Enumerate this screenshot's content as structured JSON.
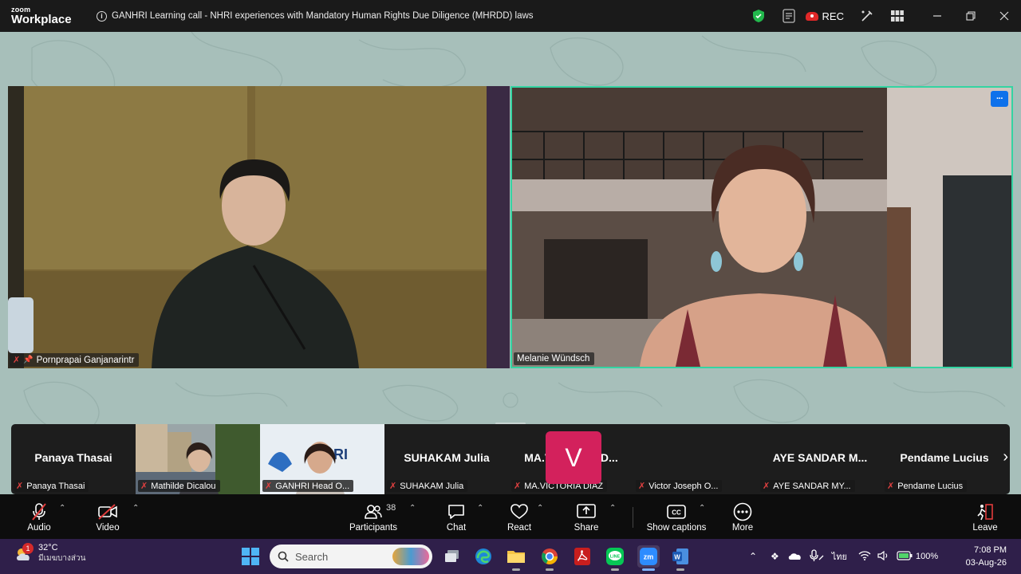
{
  "app": {
    "logo_top": "zoom",
    "logo_bottom": "Workplace"
  },
  "meeting": {
    "title": "GANHRI Learning call - NHRI experiences with Mandatory Human Rights Due Diligence (MHRDD) laws",
    "rec_label": "REC"
  },
  "speakers": [
    {
      "name": "Pornprapai Ganjanarintr",
      "muted": true,
      "pinned": true
    },
    {
      "name": "Melanie Wündsch",
      "muted": false,
      "active": true
    }
  ],
  "gallery": [
    {
      "display": "Panaya Thasai",
      "name": "Panaya Thasai",
      "video": false
    },
    {
      "display": "",
      "name": "Mathilde Dicalou",
      "video": true
    },
    {
      "display": "",
      "name": "GANHRI Head O...",
      "video": true
    },
    {
      "display": "SUHAKAM Julia",
      "name": "SUHAKAM Julia",
      "video": false
    },
    {
      "display": "MA.VICTORIA  D...",
      "name": "MA.VICTORIA DIAZ",
      "video": false
    },
    {
      "display": "V",
      "name": "Victor Joseph O...",
      "video": false
    },
    {
      "display": "AYE SANDAR M...",
      "name": "AYE SANDAR MY...",
      "video": false
    },
    {
      "display": "Pendame Lucius",
      "name": "Pendame Lucius",
      "video": false
    }
  ],
  "toolbar": {
    "audio": "Audio",
    "video": "Video",
    "participants": "Participants",
    "participants_count": "38",
    "chat": "Chat",
    "react": "React",
    "share": "Share",
    "captions": "Show captions",
    "more": "More",
    "leave": "Leave"
  },
  "taskbar": {
    "temperature": "32°C",
    "weather_text": "มีเมฆบางส่วน",
    "weather_badge": "1",
    "search_placeholder": "Search",
    "battery": "100%",
    "language": "ไทย",
    "time": "7:08 PM",
    "date": "03-Aug-26"
  },
  "colors": {
    "active_speaker_border": "#34d4a2",
    "meeting_bg": "#a7bfba",
    "avatar_v": "#d3215c",
    "rec_red": "#e02828"
  }
}
